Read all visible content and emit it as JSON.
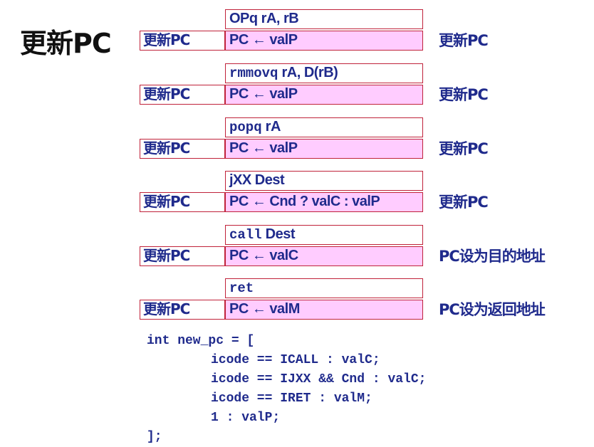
{
  "title": "更新PC",
  "blocks": [
    {
      "instr": [
        {
          "text": "OPq rA, rB",
          "mono": false
        }
      ],
      "stage": "更新PC",
      "action": "PC ← valP",
      "note": "更新PC"
    },
    {
      "instr": [
        {
          "text": "rmmovq",
          "mono": true
        },
        {
          "text": " rA, D(rB)",
          "mono": false
        }
      ],
      "stage": "更新PC",
      "action": "PC ← valP",
      "note": "更新PC"
    },
    {
      "instr": [
        {
          "text": "popq",
          "mono": true
        },
        {
          "text": " rA",
          "mono": false
        }
      ],
      "stage": "更新PC",
      "action": "PC ← valP",
      "note": "更新PC"
    },
    {
      "instr": [
        {
          "text": "jXX Dest",
          "mono": false
        }
      ],
      "stage": "更新PC",
      "action": "PC ← Cnd ? valC : valP",
      "note": "更新PC"
    },
    {
      "instr": [
        {
          "text": "call",
          "mono": true
        },
        {
          "text": " Dest",
          "mono": false
        }
      ],
      "stage": "更新PC",
      "action": "PC ← valC",
      "note": "PC设为目的地址"
    },
    {
      "instr": [
        {
          "text": "ret",
          "mono": true
        }
      ],
      "stage": "更新PC",
      "action": "PC ← valM",
      "note": "PC设为返回地址"
    }
  ],
  "code": [
    "int new_pc = [",
    "icode == ICALL : valC;",
    "icode == IJXX && Cnd : valC;",
    "icode == IRET : valM;",
    "1 : valP;",
    "];"
  ]
}
